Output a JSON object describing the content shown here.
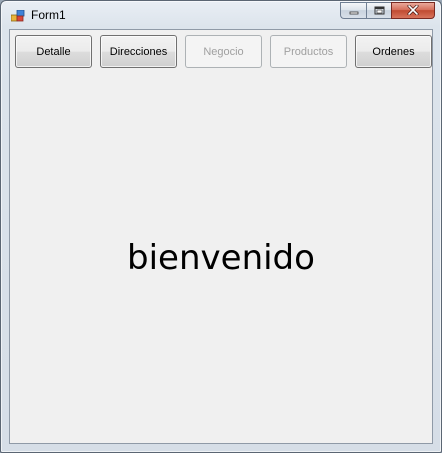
{
  "window": {
    "title": "Form1"
  },
  "toolbar": {
    "buttons": [
      {
        "label": "Detalle",
        "enabled": true
      },
      {
        "label": "Direcciones",
        "enabled": true
      },
      {
        "label": "Negocio",
        "enabled": false
      },
      {
        "label": "Productos",
        "enabled": false
      },
      {
        "label": "Ordenes",
        "enabled": true
      }
    ]
  },
  "main": {
    "welcome_text": "bienvenido"
  },
  "icons": {
    "app": "form-app-icon",
    "minimize": "minimize-icon",
    "maximize": "maximize-icon",
    "close": "close-icon"
  },
  "colors": {
    "client_background": "#f0f0f0",
    "close_button": "#c04a31",
    "disabled_text": "#a0a0a0"
  }
}
